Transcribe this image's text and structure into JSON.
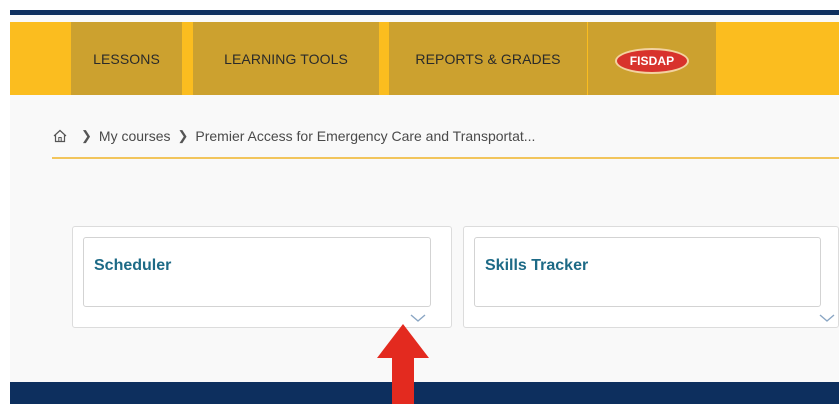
{
  "nav": {
    "items": [
      {
        "label": "LESSONS"
      },
      {
        "label": "LEARNING TOOLS"
      },
      {
        "label": "REPORTS & GRADES"
      }
    ],
    "fisdap_label": "FISDAP"
  },
  "breadcrumb": {
    "home_icon": "home-icon",
    "items": [
      {
        "label": "My courses"
      },
      {
        "label": "Premier Access for Emergency Care and Transportat..."
      }
    ]
  },
  "cards": [
    {
      "title": "Scheduler",
      "icon": "chevron-down-icon"
    },
    {
      "title": "Skills Tracker",
      "icon": "chevron-down-icon"
    }
  ],
  "colors": {
    "navbar": "#fbbd1f",
    "nav_item": "#cca12f",
    "dark_navy": "#0d2f5e",
    "card_title": "#1d6a86",
    "annotation_arrow": "#e32a1f",
    "fisdap_badge": "#d8322c"
  }
}
